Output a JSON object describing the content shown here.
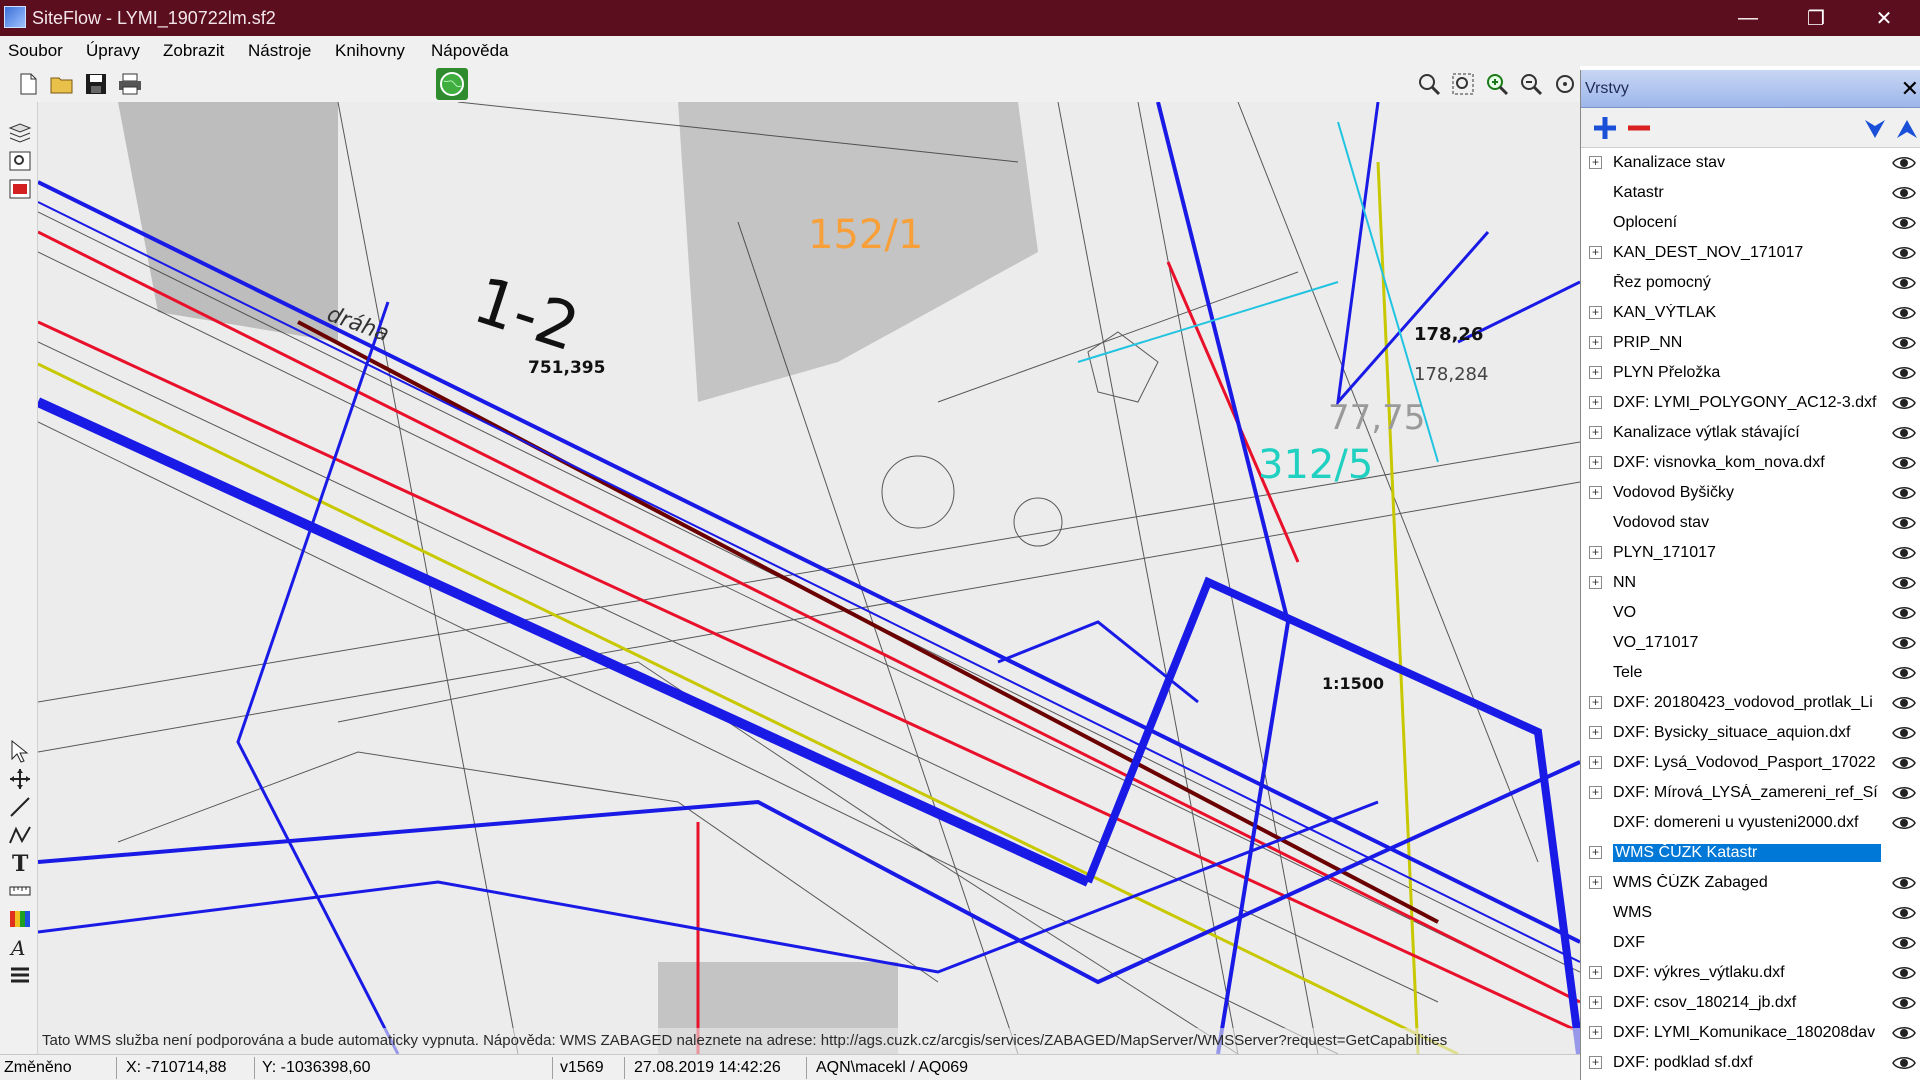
{
  "window": {
    "title": "SiteFlow - LYMI_190722lm.sf2",
    "minimize": "—",
    "maximize": "❐",
    "close": "✕"
  },
  "menu": [
    "Soubor",
    "Úpravy",
    "Zobrazit",
    "Nástroje",
    "Knihovny",
    "Nápověda"
  ],
  "map": {
    "labels": {
      "parcel_a": "152/1",
      "parcel_b": "312/5",
      "dim_1": "751,395",
      "dim_2": "178,26",
      "dim_3": "178,284",
      "scale": "1:1500",
      "section": "1-2",
      "hatch": "dráha",
      "value_775": "77,75"
    },
    "notice": "Tato WMS služba není podporována a bude automaticky vypnuta. Nápověda: WMS ZABAGED naleznete na adrese: http://ags.cuzk.cz/arcgis/services/ZABAGED/MapServer/WMSServer?request=GetCapabilities"
  },
  "layers": {
    "title": "Vrstvy",
    "items": [
      {
        "name": "Kanalizace stav",
        "expandable": true
      },
      {
        "name": "Katastr",
        "expandable": false
      },
      {
        "name": "Oplocení",
        "expandable": false
      },
      {
        "name": "KAN_DEST_NOV_171017",
        "expandable": true
      },
      {
        "name": "Řez pomocný",
        "expandable": false
      },
      {
        "name": "KAN_VÝTLAK",
        "expandable": true
      },
      {
        "name": "PRIP_NN",
        "expandable": true
      },
      {
        "name": "PLYN Přeložka",
        "expandable": true
      },
      {
        "name": "DXF: LYMI_POLYGONY_AC12-3.dxf",
        "expandable": true
      },
      {
        "name": "Kanalizace výtlak stávající",
        "expandable": true
      },
      {
        "name": "DXF: visnovka_kom_nova.dxf",
        "expandable": true
      },
      {
        "name": "Vodovod Byšičky",
        "expandable": true
      },
      {
        "name": "Vodovod stav",
        "expandable": false
      },
      {
        "name": "PLYN_171017",
        "expandable": true
      },
      {
        "name": "NN",
        "expandable": true
      },
      {
        "name": "VO",
        "expandable": false
      },
      {
        "name": "VO_171017",
        "expandable": false
      },
      {
        "name": "Tele",
        "expandable": false
      },
      {
        "name": "DXF: 20180423_vodovod_protlak_Li",
        "expandable": true
      },
      {
        "name": "DXF: Bysicky_situace_aquion.dxf",
        "expandable": true
      },
      {
        "name": "DXF: Lysá_Vodovod_Pasport_17022",
        "expandable": true
      },
      {
        "name": "DXF: Mírová_LYSÁ_zamereni_ref_Sí",
        "expandable": true
      },
      {
        "name": "DXF: domereni u vyusteni2000.dxf",
        "expandable": false
      },
      {
        "name": "WMS ČÚZK Katastr",
        "expandable": true,
        "selected": true
      },
      {
        "name": "WMS ČÚZK Zabaged",
        "expandable": true
      },
      {
        "name": "WMS",
        "expandable": false
      },
      {
        "name": "DXF",
        "expandable": false
      },
      {
        "name": "DXF: výkres_výtlaku.dxf",
        "expandable": true
      },
      {
        "name": "DXF: csov_180214_jb.dxf",
        "expandable": true
      },
      {
        "name": "DXF: LYMI_Komunikace_180208dav",
        "expandable": true
      },
      {
        "name": "DXF: podklad sf.dxf",
        "expandable": true
      }
    ]
  },
  "status": {
    "state": "Změněno",
    "x": "X: -710714,88",
    "y": "Y: -1036398,60",
    "version": "v1569",
    "datetime": "27.08.2019 14:42:26",
    "user": "AQN\\macekl / AQ069"
  },
  "colors": {
    "titlebar": "#5a0e1e",
    "selection": "#0078d7",
    "pipe_blue": "#1a1ae6",
    "pipe_red": "#e8102a",
    "pipe_yellow": "#c8c800"
  }
}
